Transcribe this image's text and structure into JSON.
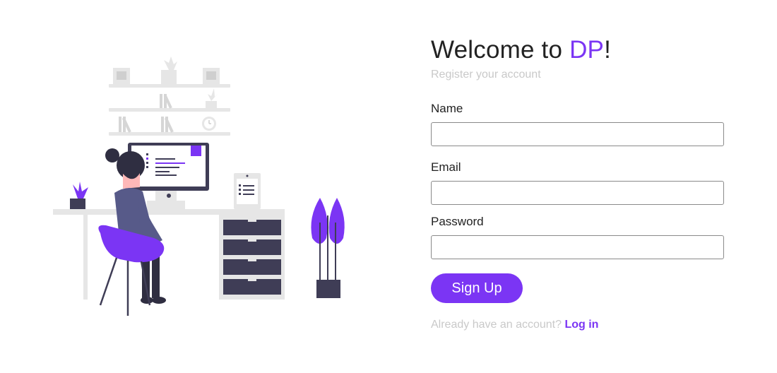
{
  "colors": {
    "accent": "#7b35f4",
    "text": "#222222",
    "muted": "#c9c9c9",
    "illustration_gray": "#e6e6e6",
    "illustration_dark": "#3f3d56"
  },
  "illustration": {
    "icon": "woman-working-at-desk-illustration"
  },
  "form": {
    "title_prefix": "Welcome to ",
    "title_brand": "DP",
    "title_suffix": "!",
    "subtitle": "Register your account",
    "fields": {
      "name": {
        "label": "Name",
        "value": "",
        "placeholder": ""
      },
      "email": {
        "label": "Email",
        "value": "",
        "placeholder": ""
      },
      "password": {
        "label": "Password",
        "value": "",
        "placeholder": ""
      }
    },
    "submit_label": "Sign Up",
    "login_prompt": "Already have an account?",
    "login_link": "Log in"
  }
}
